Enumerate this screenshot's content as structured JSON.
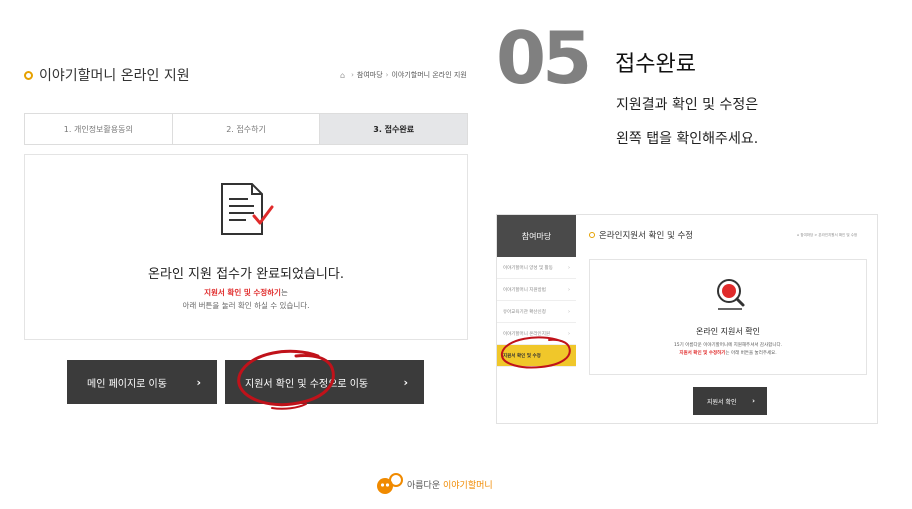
{
  "main": {
    "title": "이야기할머니 온라인 지원",
    "breadcrumb": {
      "items": [
        "참여마당",
        "이야기할머니 온라인 지원"
      ]
    },
    "steps": [
      {
        "label": "1. 개인정보활용동의",
        "active": false
      },
      {
        "label": "2. 접수하기",
        "active": false
      },
      {
        "label": "3. 접수완료",
        "active": true
      }
    ],
    "complete_message": "온라인 지원 접수가 완료되었습니다.",
    "sub_highlight": "지원서 확인 및 수정하기",
    "sub_suffix": "는",
    "sub_line2": "아래 버튼을 눌러 확인 하실 수 있습니다.",
    "buttons": {
      "main_label": "메인 페이지로 이동",
      "edit_label": "지원서 확인 및 수정으로 이동"
    }
  },
  "step": {
    "number": "05",
    "title": "접수완료",
    "desc_line1": "지원결과 확인 및 수정은",
    "desc_line2": "왼쪽 탭을 확인해주세요."
  },
  "preview": {
    "sidebar_header": "참여마당",
    "menu": [
      {
        "label": "이야기할머니 양성 및 활동",
        "active": false
      },
      {
        "label": "이야기할머니 지원방법",
        "active": false
      },
      {
        "label": "유아교육기관 확산신청",
        "active": false
      },
      {
        "label": "이야기할머니 온라인지원",
        "active": false
      },
      {
        "label": "지원서 확인 및 수정",
        "active": true
      }
    ],
    "title": "온라인지원서 확인 및 수정",
    "breadcrumb": "참여마당 > 온라인지원서 확인 및 수정",
    "message": "온라인 지원서 확인",
    "sub1": "15기 아름다운 이야기할머니에 지원해주셔서 감사합니다.",
    "sub2_highlight": "지원서 확인 및 수정하기",
    "sub2_suffix": "는 아래 버튼을 눌러주세요.",
    "button_label": "지원서 확인"
  },
  "footer": {
    "logo_text_a": "아름다운 ",
    "logo_text_b": "이야기할머니"
  },
  "colors": {
    "accent_orange": "#e6a100",
    "highlight_red": "#e02b2b",
    "active_yellow": "#f0c72a",
    "button_dark": "#3b3b3b"
  },
  "icons": [
    "home-icon",
    "document-check-icon",
    "magnifier-icon",
    "arrow-right-icon",
    "grandmother-logo-icon"
  ]
}
